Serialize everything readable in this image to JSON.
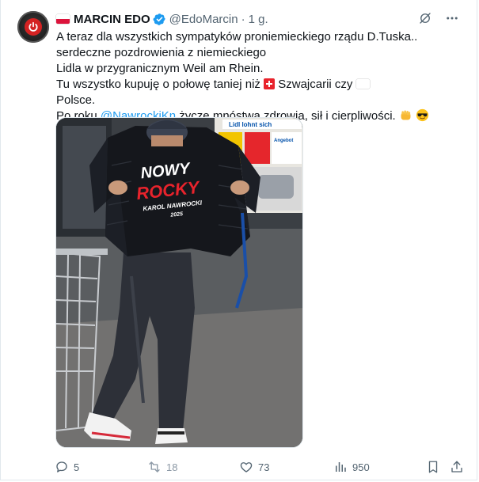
{
  "tweet": {
    "author": {
      "name": "MARCIN EDO",
      "handle": "@EdoMarcin",
      "separator": "·",
      "time": "1 g."
    },
    "text": {
      "line1": "A teraz dla wszystkich sympatyków proniemieckiego rządu D.Tuska..",
      "line2a": "serdeczne pozdrowienia z niemieckiego ",
      "line2b": " Lidla w przygranicznym Weil am Rhein.",
      "line3a": "Tu wszystko kupuję o połowę taniej niż ",
      "line3b": " Szwajcarii czy ",
      "line3c": " Polsce.",
      "line4a": "Po roku ",
      "mention": "@NawrockiKn",
      "line4b": " życzę mnóstwa zdrowia, sił i cierpliwości. "
    },
    "media": {
      "shirt_text": [
        "NOWY",
        "ROCKY",
        "KAROL NAWROCKI",
        "2025"
      ],
      "store_sign": "Lidl lohnt sich",
      "store_label": "Angebot"
    },
    "actions": {
      "replies": "5",
      "retweets": "18",
      "likes": "73",
      "views": "950"
    }
  },
  "colors": {
    "accent": "#1d9bf0",
    "text_secondary": "#536471",
    "retweet_muted": "#8b98a5"
  },
  "icons": [
    "power-icon",
    "verified-badge-icon",
    "grok-icon",
    "more-icon",
    "reply-icon",
    "retweet-icon",
    "like-icon",
    "views-icon",
    "bookmark-icon",
    "share-icon"
  ]
}
